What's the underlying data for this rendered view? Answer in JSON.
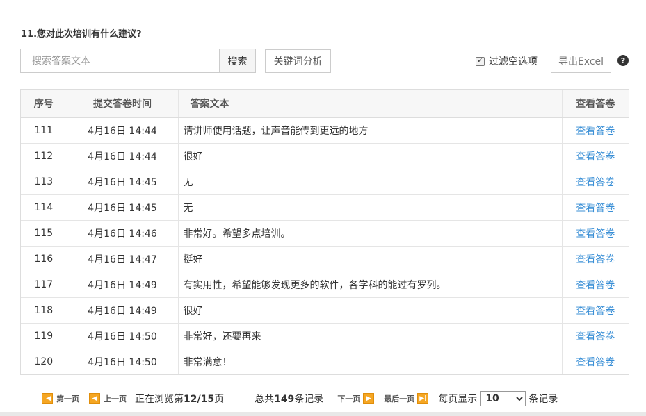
{
  "question": {
    "title": "11.您对此次培训有什么建议?"
  },
  "toolbar": {
    "search_placeholder": "搜索答案文本",
    "search_label": "搜索",
    "keyword_label": "关键词分析",
    "filter_label": "过滤空选项",
    "filter_checked": true,
    "export_label": "导出Excel",
    "help_glyph": "?"
  },
  "table": {
    "headers": {
      "index": "序号",
      "time": "提交答卷时间",
      "text": "答案文本",
      "view": "查看答卷"
    },
    "rows": [
      {
        "index": "111",
        "time": "4月16日 14:44",
        "text": "请讲师使用话题，让声音能传到更远的地方",
        "view": "查看答卷"
      },
      {
        "index": "112",
        "time": "4月16日 14:44",
        "text": "很好",
        "view": "查看答卷"
      },
      {
        "index": "113",
        "time": "4月16日 14:45",
        "text": "无",
        "view": "查看答卷"
      },
      {
        "index": "114",
        "time": "4月16日 14:45",
        "text": "无",
        "view": "查看答卷"
      },
      {
        "index": "115",
        "time": "4月16日 14:46",
        "text": "非常好。希望多点培训。",
        "view": "查看答卷"
      },
      {
        "index": "116",
        "time": "4月16日 14:47",
        "text": "挺好",
        "view": "查看答卷"
      },
      {
        "index": "117",
        "time": "4月16日 14:49",
        "text": "有实用性，希望能够发现更多的软件，各学科的能过有罗列。",
        "view": "查看答卷"
      },
      {
        "index": "118",
        "time": "4月16日 14:49",
        "text": "很好",
        "view": "查看答卷"
      },
      {
        "index": "119",
        "time": "4月16日 14:50",
        "text": "非常好，还要再来",
        "view": "查看答卷"
      },
      {
        "index": "120",
        "time": "4月16日 14:50",
        "text": "非常满意！",
        "view": "查看答卷"
      }
    ]
  },
  "pagination": {
    "first_label": "第一页",
    "prev_label": "上一页",
    "browsing_prefix": "正在浏览第",
    "current_page": "12/15",
    "browsing_suffix": "页",
    "total_prefix": "总共",
    "total_count": "149",
    "total_suffix": "条记录",
    "next_label": "下一页",
    "last_label": "最后一页",
    "page_size_prefix": "每页显示",
    "page_size": "10",
    "page_size_suffix": "条记录"
  },
  "icons": {
    "first_page": "first-page-icon",
    "prev_page": "prev-page-icon",
    "next_page": "next-page-icon",
    "last_page": "last-page-icon",
    "help": "help-icon",
    "check": "checkmark-icon"
  },
  "colors": {
    "link": "#3a8fd6",
    "pager_icon": "#f5a623"
  }
}
